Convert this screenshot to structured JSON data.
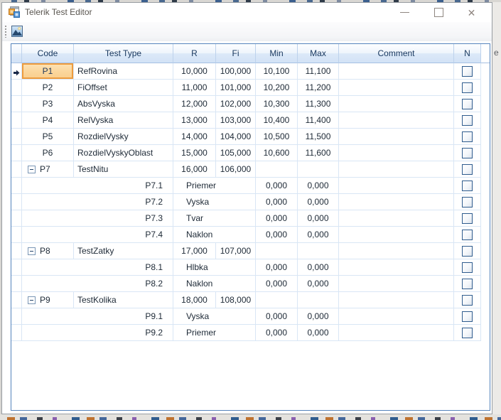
{
  "window": {
    "title": "Telerik Test Editor",
    "controls": {
      "minimize": "minimize",
      "maximize": "maximize",
      "close": "✕"
    }
  },
  "toolbar": {
    "buttons": [
      {
        "name": "image-button",
        "icon": "image-icon"
      }
    ]
  },
  "grid": {
    "columns": [
      "Code",
      "Test Type",
      "R",
      "Fi",
      "Min",
      "Max",
      "Comment",
      "N"
    ],
    "rows": [
      {
        "code": "P1",
        "type": "RefRovina",
        "r": "10,000",
        "fi": "100,000",
        "min": "10,100",
        "max": "11,100",
        "comment": "",
        "checked": false,
        "level": 0,
        "expandable": false,
        "current": true,
        "selected_cell": "code"
      },
      {
        "code": "P2",
        "type": "FiOffset",
        "r": "11,000",
        "fi": "101,000",
        "min": "10,200",
        "max": "11,200",
        "comment": "",
        "checked": false,
        "level": 0,
        "expandable": false
      },
      {
        "code": "P3",
        "type": "AbsVyska",
        "r": "12,000",
        "fi": "102,000",
        "min": "10,300",
        "max": "11,300",
        "comment": "",
        "checked": false,
        "level": 0,
        "expandable": false
      },
      {
        "code": "P4",
        "type": "RelVyska",
        "r": "13,000",
        "fi": "103,000",
        "min": "10,400",
        "max": "11,400",
        "comment": "",
        "checked": false,
        "level": 0,
        "expandable": false
      },
      {
        "code": "P5",
        "type": "RozdielVysky",
        "r": "14,000",
        "fi": "104,000",
        "min": "10,500",
        "max": "11,500",
        "comment": "",
        "checked": false,
        "level": 0,
        "expandable": false
      },
      {
        "code": "P6",
        "type": "RozdielVyskyOblast",
        "r": "15,000",
        "fi": "105,000",
        "min": "10,600",
        "max": "11,600",
        "comment": "",
        "checked": false,
        "level": 0,
        "expandable": false
      },
      {
        "code": "P7",
        "type": "TestNitu",
        "r": "16,000",
        "fi": "106,000",
        "min": "",
        "max": "",
        "comment": "",
        "checked": false,
        "level": 0,
        "expandable": true,
        "expanded": true
      },
      {
        "code": "P7.1",
        "type": "Priemer",
        "min": "0,000",
        "max": "0,000",
        "comment": "",
        "checked": false,
        "level": 1
      },
      {
        "code": "P7.2",
        "type": "Vyska",
        "min": "0,000",
        "max": "0,000",
        "comment": "",
        "checked": false,
        "level": 1
      },
      {
        "code": "P7.3",
        "type": "Tvar",
        "min": "0,000",
        "max": "0,000",
        "comment": "",
        "checked": false,
        "level": 1
      },
      {
        "code": "P7.4",
        "type": "Naklon",
        "min": "0,000",
        "max": "0,000",
        "comment": "",
        "checked": false,
        "level": 1
      },
      {
        "code": "P8",
        "type": "TestZatky",
        "r": "17,000",
        "fi": "107,000",
        "min": "",
        "max": "",
        "comment": "",
        "checked": false,
        "level": 0,
        "expandable": true,
        "expanded": true
      },
      {
        "code": "P8.1",
        "type": "Hlbka",
        "min": "0,000",
        "max": "0,000",
        "comment": "",
        "checked": false,
        "level": 1
      },
      {
        "code": "P8.2",
        "type": "Naklon",
        "min": "0,000",
        "max": "0,000",
        "comment": "",
        "checked": false,
        "level": 1
      },
      {
        "code": "P9",
        "type": "TestKolika",
        "r": "18,000",
        "fi": "108,000",
        "min": "",
        "max": "",
        "comment": "",
        "checked": false,
        "level": 0,
        "expandable": true,
        "expanded": true
      },
      {
        "code": "P9.1",
        "type": "Vyska",
        "min": "0,000",
        "max": "0,000",
        "comment": "",
        "checked": false,
        "level": 1
      },
      {
        "code": "P9.2",
        "type": "Priemer",
        "min": "0,000",
        "max": "0,000",
        "comment": "",
        "checked": false,
        "level": 1
      }
    ]
  },
  "colors": {
    "selection_fill": "#fbd69c",
    "selection_border": "#ee9c3d",
    "grid_border": "#5583bc",
    "grid_line": "#d9e6f5",
    "header_text": "#17375e",
    "checkbox_border": "#2f5c8e"
  },
  "artifacts": {
    "right_edge_text": "e"
  }
}
